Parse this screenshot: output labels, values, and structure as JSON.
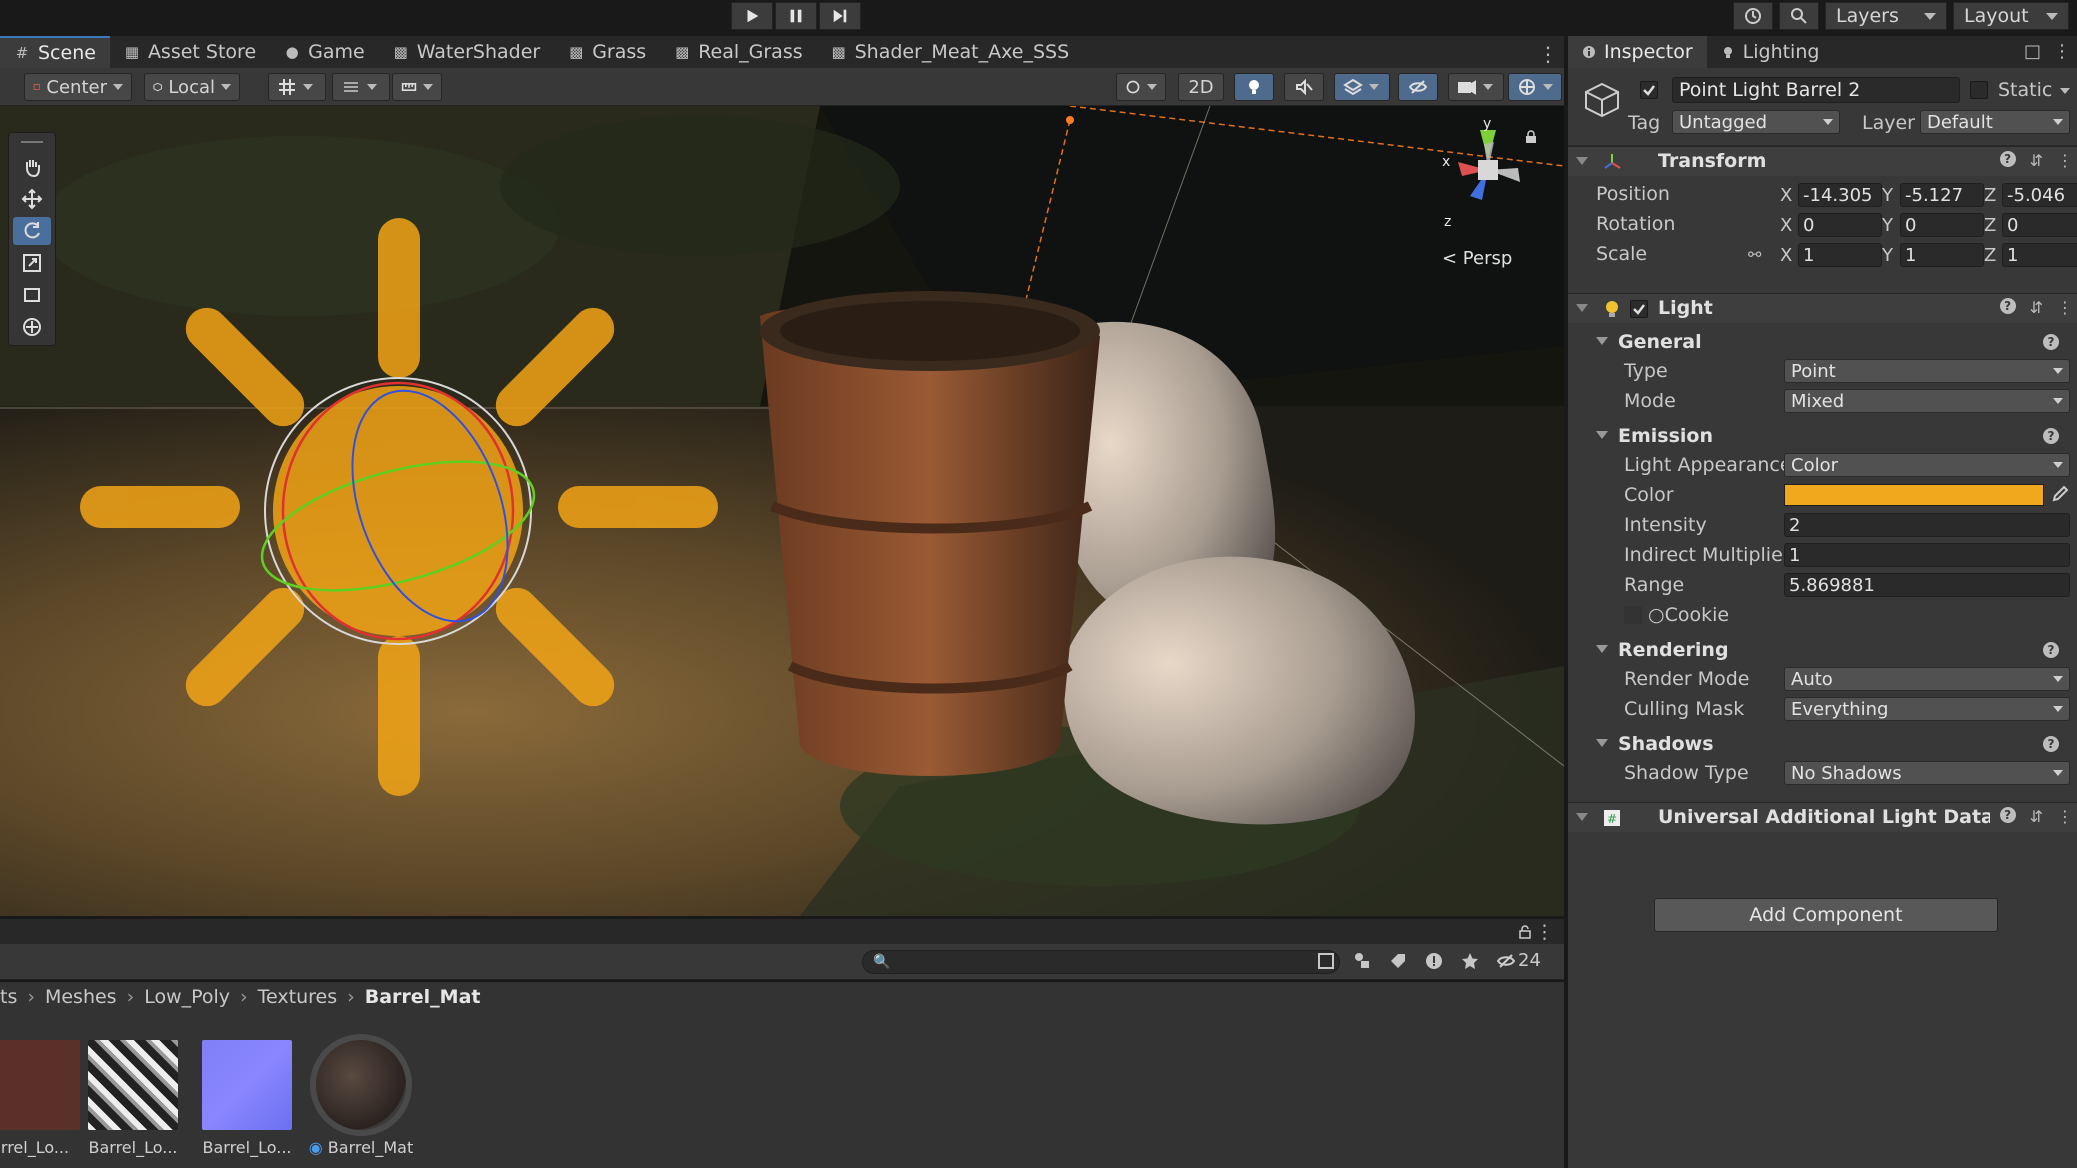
{
  "toolbar": {
    "layers_label": "Layers",
    "layout_label": "Layout"
  },
  "scene_tabs": [
    {
      "label": "Scene",
      "icon": "grid-icon"
    },
    {
      "label": "Asset Store",
      "icon": "store-icon"
    },
    {
      "label": "Game",
      "icon": "gamepad-icon"
    },
    {
      "label": "WaterShader",
      "icon": "shader-icon"
    },
    {
      "label": "Grass",
      "icon": "shader-icon"
    },
    {
      "label": "Real_Grass",
      "icon": "shader-icon"
    },
    {
      "label": "Shader_Meat_Axe_SSS",
      "icon": "shader-icon"
    }
  ],
  "scene_toolbar": {
    "pivot_label": "Center",
    "space_label": "Local",
    "mode_2d_label": "2D"
  },
  "viewport": {
    "axis_x": "x",
    "axis_y": "y",
    "axis_z": "z",
    "persp_label": "< Persp"
  },
  "project": {
    "hidden_count": "24",
    "breadcrumb": [
      "ts",
      "Meshes",
      "Low_Poly",
      "Textures",
      "Barrel_Mat"
    ],
    "assets": [
      {
        "label": "rrel_Lo..."
      },
      {
        "label": "Barrel_Lo..."
      },
      {
        "label": "Barrel_Lo..."
      },
      {
        "label": "Barrel_Mat"
      }
    ]
  },
  "inspector": {
    "tabs": [
      {
        "label": "Inspector"
      },
      {
        "label": "Lighting"
      }
    ],
    "object_name": "Point Light Barrel 2",
    "static_label": "Static",
    "tag_label": "Tag",
    "tag_value": "Untagged",
    "layer_label": "Layer",
    "layer_value": "Default",
    "transform": {
      "title": "Transform",
      "position_label": "Position",
      "rotation_label": "Rotation",
      "scale_label": "Scale",
      "position": {
        "x": "-14.305",
        "y": "-5.127",
        "z": "-5.046"
      },
      "rotation": {
        "x": "0",
        "y": "0",
        "z": "0"
      },
      "scale": {
        "x": "1",
        "y": "1",
        "z": "1"
      }
    },
    "light": {
      "title": "Light",
      "general_title": "General",
      "type_label": "Type",
      "type_value": "Point",
      "mode_label": "Mode",
      "mode_value": "Mixed",
      "emission_title": "Emission",
      "appearance_label": "Light Appearance",
      "appearance_value": "Color",
      "color_label": "Color",
      "color_value": "#f1a81c",
      "intensity_label": "Intensity",
      "intensity_value": "2",
      "indirect_label": "Indirect Multiplier",
      "indirect_value": "1",
      "range_label": "Range",
      "range_value": "5.869881",
      "cookie_label": "Cookie",
      "rendering_title": "Rendering",
      "render_mode_label": "Render Mode",
      "render_mode_value": "Auto",
      "culling_label": "Culling Mask",
      "culling_value": "Everything",
      "shadows_title": "Shadows",
      "shadow_type_label": "Shadow Type",
      "shadow_type_value": "No Shadows"
    },
    "urp_title": "Universal Additional Light Data (Scr",
    "add_component_label": "Add Component"
  }
}
